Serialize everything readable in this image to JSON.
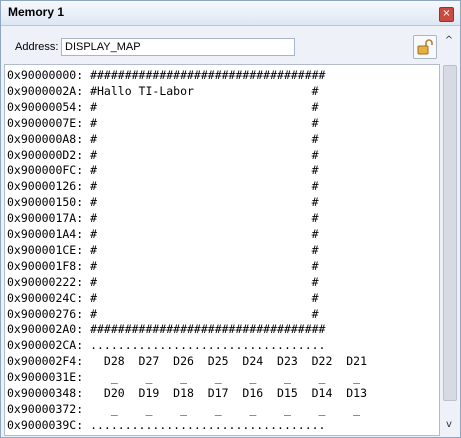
{
  "window": {
    "title": "Memory 1",
    "close_glyph": "×"
  },
  "address": {
    "label": "Address:",
    "value": "DISPLAY_MAP",
    "lock_icon": "unlock-icon"
  },
  "scrollbar": {
    "up_glyph": "^",
    "down_glyph": "v"
  },
  "memory_lines": [
    "0x90000000: ##################################",
    "0x9000002A: #Hallo TI-Labor                 #",
    "0x90000054: #                               #",
    "0x9000007E: #                               #",
    "0x900000A8: #                               #",
    "0x900000D2: #                               #",
    "0x900000FC: #                               #",
    "0x90000126: #                               #",
    "0x90000150: #                               #",
    "0x9000017A: #                               #",
    "0x900001A4: #                               #",
    "0x900001CE: #                               #",
    "0x900001F8: #                               #",
    "0x90000222: #                               #",
    "0x9000024C: #                               #",
    "0x90000276: #                               #",
    "0x900002A0: ##################################",
    "0x900002CA: ..................................",
    "0x900002F4:   D28  D27  D26  D25  D24  D23  D22  D21",
    "0x9000031E:    _    _    _    _    _    _    _    _",
    "0x90000348:   D20  D19  D18  D17  D16  D15  D14  D13",
    "0x90000372:    _    _    _    _    _    _    _    _",
    "0x9000039C: .................................."
  ]
}
